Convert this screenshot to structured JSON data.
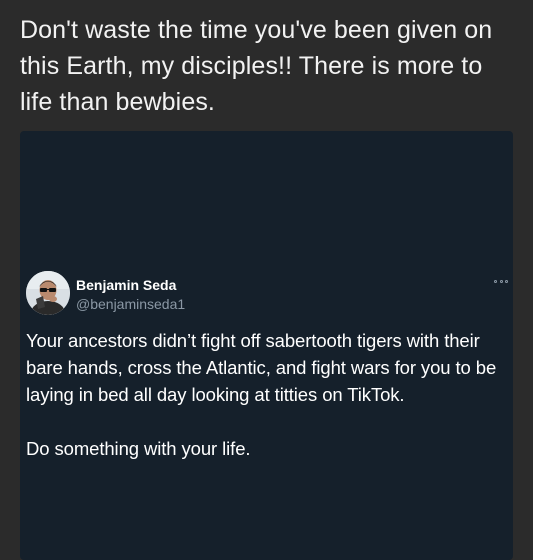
{
  "post": {
    "caption": "Don't waste the time you've been given on this Earth, my disciples!! There is more to life than bewbies."
  },
  "tweet": {
    "author": {
      "display_name": "Benjamin Seda",
      "handle": "@benjaminseda1"
    },
    "more_icon": "more-options-icon",
    "paragraphs": [
      "Your ancestors didn’t fight off sabertooth tigers with their bare hands, cross the Atlantic, and fight wars for you to be laying in bed all day looking at titties on TikTok.",
      "Do something with your life."
    ]
  },
  "colors": {
    "page_background": "#2b2b2b",
    "card_background": "#15202b",
    "text_primary": "#ffffff",
    "text_secondary": "#8b98a5"
  }
}
